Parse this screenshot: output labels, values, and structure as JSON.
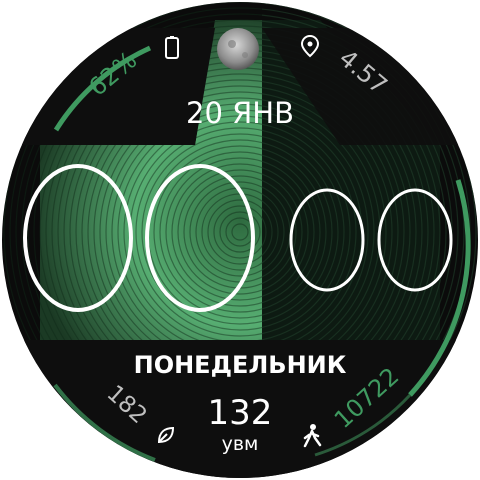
{
  "colors": {
    "accent": "#3f9a60",
    "accent_light": "#7fd39a",
    "bezel": "#0c0c0c",
    "face": "#000000",
    "text": "#ffffff",
    "muted": "#bfbfbf"
  },
  "date": "20 ЯНВ",
  "weekday": "ПОНЕДЕЛЬНИК",
  "time": {
    "hours": "00",
    "minutes": "00"
  },
  "battery": {
    "value": "62%",
    "icon": "battery-icon"
  },
  "moon": {
    "icon": "moon-phase-icon"
  },
  "distance": {
    "value": "4.57",
    "icon": "location-pin-icon"
  },
  "floors": {
    "value": "182",
    "icon": "stairs-leaf-icon"
  },
  "heart_rate": {
    "value": "132",
    "unit": "увм"
  },
  "steps": {
    "value": "10722",
    "icon": "walking-person-icon"
  },
  "step_goal_progress": 0.6,
  "battery_progress": 0.62
}
